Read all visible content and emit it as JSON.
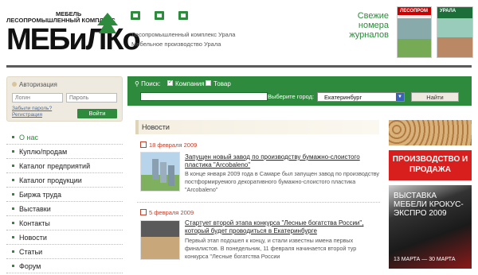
{
  "logo": {
    "line1": "МЕБЕЛЬ",
    "line2": "ЛЕСОПРОМЫШЛЕННЫЙ КОМПЛЕКС",
    "brand": "МЕБиЛКо"
  },
  "tagline": {
    "line1": "Лесопромышленный комплекс Урала",
    "line2": "Мебельное производство Урала"
  },
  "magazines": {
    "title": "Свежие номера журналов",
    "mag1_label": "ЛЕСОПРОМ",
    "mag2_label": "УРАЛА"
  },
  "auth": {
    "title": "Авторизация",
    "login_placeholder": "Логин",
    "password_placeholder": "Пароль",
    "forgot": "Забыли пароль?",
    "register": "Регистрация",
    "enter": "Войти"
  },
  "menu": [
    {
      "label": "О нас"
    },
    {
      "label": "Куплю/продам"
    },
    {
      "label": "Каталог предприятий"
    },
    {
      "label": "Каталог продукции"
    },
    {
      "label": "Биржа труда"
    },
    {
      "label": "Выставки"
    },
    {
      "label": "Контакты"
    },
    {
      "label": "Новости"
    },
    {
      "label": "Статьи"
    },
    {
      "label": "Форум"
    }
  ],
  "search": {
    "label": "Поиск:",
    "opt1": "Компания",
    "opt2": "Товар",
    "city_label": "Выберите город:",
    "city": "Екатеринбург",
    "button": "Найти"
  },
  "news": {
    "heading": "Новости",
    "items": [
      {
        "date": "18 февраля 2009",
        "title": "Запущен новый завод по производству бумажно-слоистого пластика \"Arcobaleno\"",
        "text": "В конце января 2009 года в Самаре был запущен завод по производству постформируемого декоративного бумажно-слоистого пластика \"Arcobaleno\""
      },
      {
        "date": "5 февраля 2009",
        "title": "Стартует второй этапа конкурса \"Лесные богатства России\", который будет проводиться в Екатеринбурге",
        "text": "Первый этап подошел к концу, и стали известны имена первых финалистов. В понедельник, 11 февраля начинается второй тур конкурса \"Лесные богатства России"
      }
    ]
  },
  "banners": {
    "b2": "ПРОИЗВОДСТВО И ПРОДАЖА",
    "b3_title": "ВЫСТАВКА МЕБЕЛИ КРОКУС-ЭКСПРО 2009",
    "b3_dates": "13 МАРТА — 30 МАРТА"
  }
}
